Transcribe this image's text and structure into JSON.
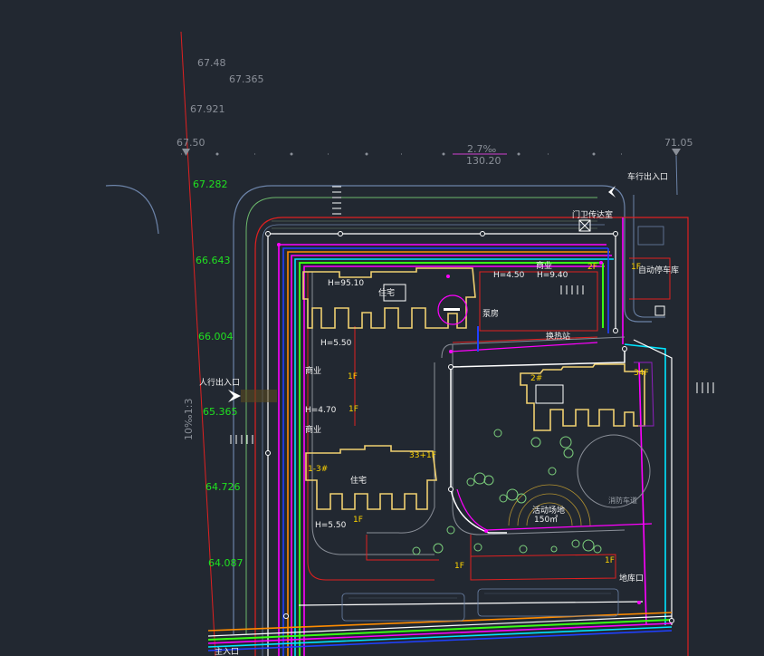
{
  "elevations_top": [
    "67.48",
    "67.365",
    "67.921",
    "67.50",
    "71.05"
  ],
  "elevations_left": [
    "67.282",
    "66.643",
    "66.004",
    "65.365",
    "64.726",
    "64.087"
  ],
  "dimension": {
    "top": "2.7‰",
    "bottom": "130.20"
  },
  "road_slope_label": "10‰1:3",
  "entrances": {
    "vehicle": "车行出入口",
    "pedestrian": "人行出入口",
    "main": "主入口",
    "basement": "地库口"
  },
  "buildings": {
    "north_height": "H=95.10",
    "north_residential": "住宅",
    "north_base_height": "H=5.50",
    "pump_room": "泵房",
    "commercial_ne": "商业",
    "commercial_ne_h1": "H=4.50",
    "commercial_ne_h2": "H=9.40",
    "floors_2f": "2F",
    "ne_small_floor": "1F",
    "ne_small_label": "自动停车库",
    "heat_station": "换热站",
    "east_tower_floors": "34F",
    "east_tower_tag": "2#",
    "west_commercial": "商业",
    "west_commercial_floor": "1F",
    "west_commercial_height": "H=4.70",
    "west_commercial_floor2": "1F",
    "west_commercial2": "商业",
    "sw_tower_tag": "1-3#",
    "sw_tower_floors": "33+1F",
    "sw_residential": "住宅",
    "sw_floor": "1F",
    "sw_height": "H=5.50",
    "bottom_floor_1": "1F",
    "bottom_floor_2": "1F",
    "fire_lane": "消防车道",
    "activity_area": "活动场地",
    "activity_area_size": "150㎡",
    "guard_label": "门卫传达室"
  },
  "colors": {
    "background": "#222831",
    "property_line": "#e02020",
    "building_outline": "#f0d070",
    "pipe_magenta": "#ff00ff",
    "pipe_cyan": "#00e5ff",
    "pipe_green": "#39ff14",
    "pipe_blue": "#2040ff",
    "pipe_orange": "#ff8c00",
    "elevation_green": "#20e020"
  }
}
